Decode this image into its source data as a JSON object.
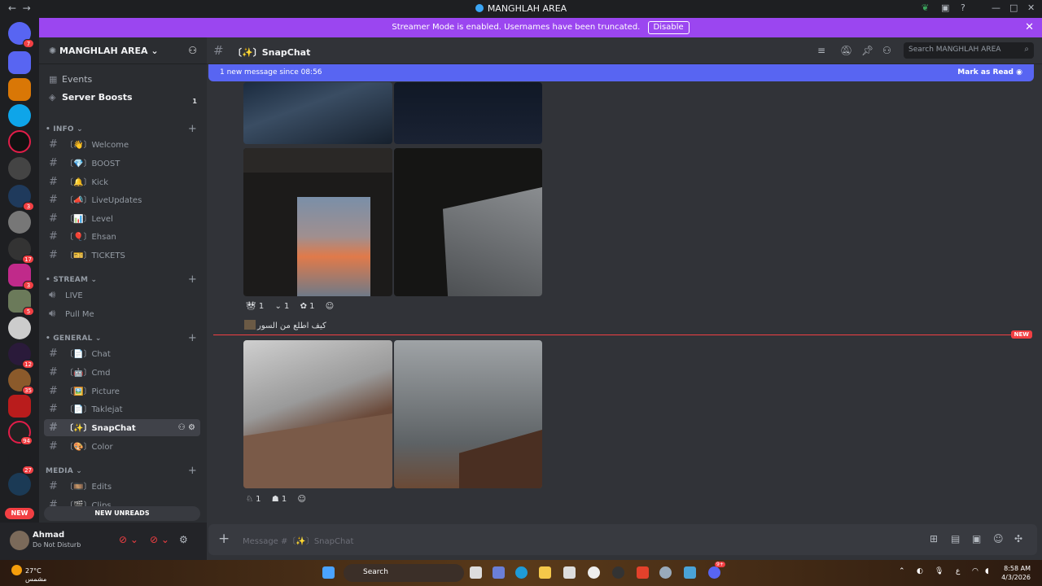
{
  "window": {
    "title": "MANGHLAH AREA"
  },
  "banner": {
    "text": "Streamer Mode is enabled. Usernames have been truncated.",
    "disable_label": "Disable"
  },
  "servers": {
    "home_badge": "7",
    "badges": [
      "3",
      "17",
      "3",
      "5",
      "12",
      "35",
      "94",
      "27"
    ],
    "new_label": "NEW"
  },
  "sidebar": {
    "server_name": "MANGHLAH AREA",
    "events_label": "Events",
    "boosts_label": "Server Boosts",
    "boosts_count": "1",
    "categories": {
      "info": "INFO",
      "stream": "STREAM",
      "general": "GENERAL",
      "media": "MEDIA"
    },
    "info_channels": [
      "〔👋〕Welcome",
      "〔💎〕BOOST",
      "〔🔔〕Kick",
      "〔📣〕LiveUpdates",
      "〔📊〕Level",
      "〔🎈〕Ehsan",
      "〔🎫〕TICKETS"
    ],
    "voice_channels": [
      "LIVE",
      "Pull Me"
    ],
    "general_channels": [
      "〔📄〕Chat",
      "〔🤖〕Cmd",
      "〔🖼️〕Picture",
      "〔📄〕Taklejat",
      "〔✨〕SnapChat",
      "〔🎨〕Color"
    ],
    "media_channels": [
      "〔🎞️〕Edits",
      "〔🎬〕Clips"
    ],
    "new_unreads": "NEW UNREADS"
  },
  "user": {
    "name": "Ahmad",
    "status": "Do Not Disturb"
  },
  "channel": {
    "name": "〔✨〕SnapChat",
    "search_placeholder": "Search MANGHLAH AREA",
    "new_messages": "1 new message since 08:56",
    "mark_as_read": "Mark as Read",
    "reactions_1": [
      "1",
      "1",
      "1"
    ],
    "message_text": "كيف اطلع من السور",
    "new_tag": "NEW",
    "reactions_2": [
      "1",
      "1"
    ],
    "composer_placeholder": "Message #〔✨〕SnapChat"
  },
  "taskbar": {
    "temp": "27°C",
    "weather": "مشمس",
    "search": "Search",
    "lang": "ع",
    "time": "8:58 AM",
    "date": "4/3/2026",
    "badge": "9+"
  }
}
